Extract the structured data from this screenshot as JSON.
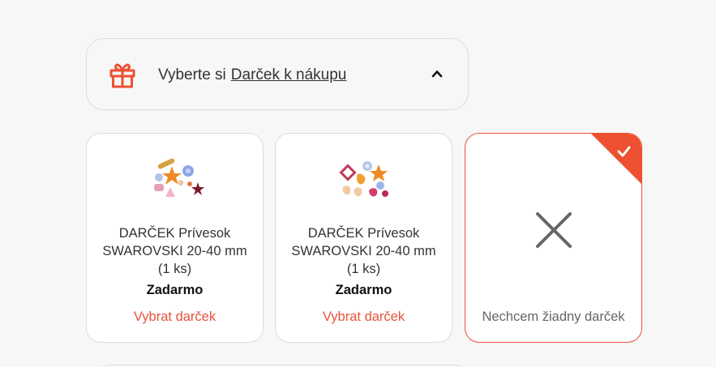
{
  "gift_header": {
    "prefix": "Vyberte si",
    "link": "Darček k nákupu",
    "icon": "gift-icon",
    "toggle_icon": "chevron-up-icon"
  },
  "colors": {
    "accent": "#ee5032",
    "action_text": "#e5533c",
    "background": "#f6f7f6",
    "card_bg": "#ffffff",
    "border": "#dcdcdc"
  },
  "gift_options": [
    {
      "name": "DARČEK Prívesok SWAROVSKI 20-40 mm (1 ks)",
      "price": "Zadarmo",
      "action": "Vybrat darček",
      "image": "swarovski-pendants-image"
    },
    {
      "name": "DARČEK Prívesok SWAROVSKI 20-40 mm (1 ks)",
      "price": "Zadarmo",
      "action": "Vybrat darček",
      "image": "swarovski-pendants-image"
    },
    {
      "label": "Nechcem žiadny darček",
      "icon": "close-icon",
      "selected": true,
      "badge_icon": "check-icon"
    }
  ]
}
